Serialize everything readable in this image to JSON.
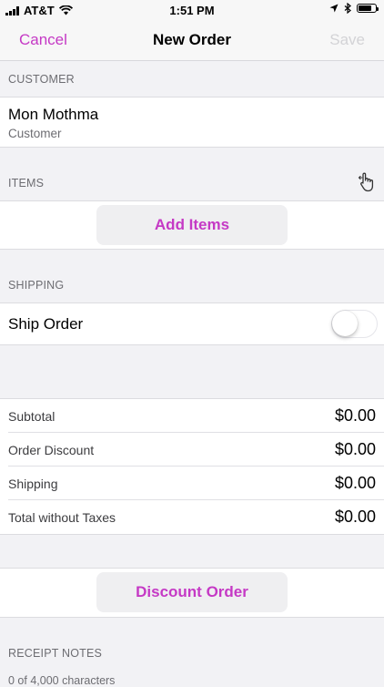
{
  "status_bar": {
    "carrier": "AT&T",
    "time": "1:51 PM",
    "battery_level": 0.75
  },
  "nav": {
    "cancel": "Cancel",
    "title": "New Order",
    "save": "Save"
  },
  "customer": {
    "header": "CUSTOMER",
    "name": "Mon Mothma",
    "subtitle": "Customer"
  },
  "items": {
    "header": "ITEMS",
    "icon": "hand-pointer-icon",
    "add_button": "Add Items"
  },
  "shipping": {
    "header": "SHIPPING",
    "ship_order_label": "Ship Order",
    "ship_order_enabled": false
  },
  "summary": {
    "rows": [
      {
        "label": "Subtotal",
        "value": "$0.00"
      },
      {
        "label": "Order Discount",
        "value": "$0.00"
      },
      {
        "label": "Shipping",
        "value": "$0.00"
      },
      {
        "label": "Total without Taxes",
        "value": "$0.00"
      }
    ]
  },
  "discount": {
    "button": "Discount Order"
  },
  "receipt_notes": {
    "header": "RECEIPT NOTES",
    "counter": "0 of 4,000 characters"
  },
  "colors": {
    "accent": "#c539c5",
    "disabled": "#d3d3d6",
    "background": "#f2f2f5"
  }
}
